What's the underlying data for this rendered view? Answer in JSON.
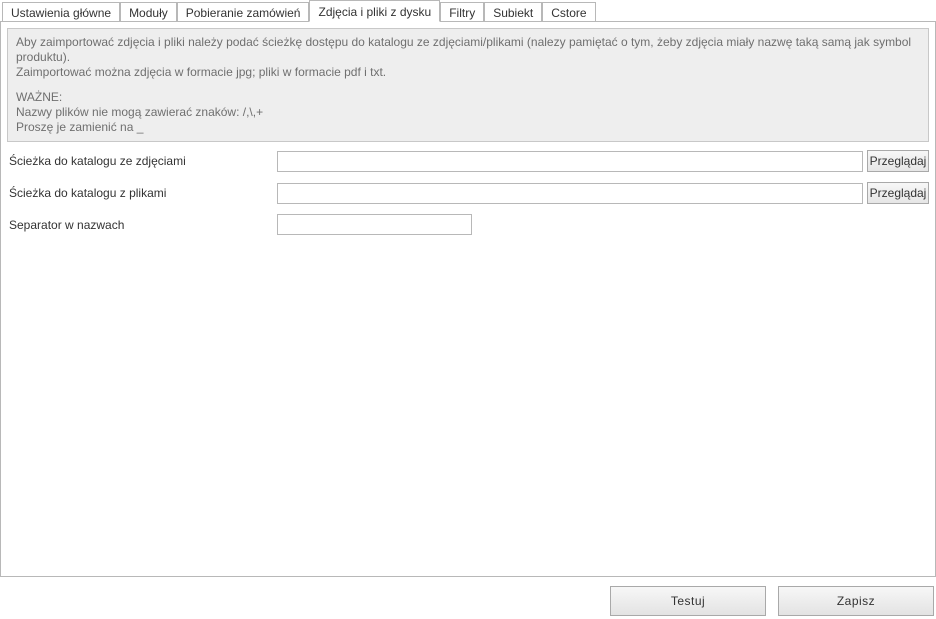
{
  "tabs": [
    {
      "label": "Ustawienia główne"
    },
    {
      "label": "Moduły"
    },
    {
      "label": "Pobieranie zamówień"
    },
    {
      "label": "Zdjęcia i pliki z dysku",
      "active": true
    },
    {
      "label": "Filtry"
    },
    {
      "label": "Subiekt"
    },
    {
      "label": "Cstore"
    }
  ],
  "info": {
    "line1": "Aby zaimportować zdjęcia i pliki należy podać ścieżkę dostępu do katalogu ze zdjęciami/plikami (nalezy pamiętać o tym, żeby zdjęcia miały nazwę taką samą jak symbol produktu).",
    "line2": "Zaimportować można zdjęcia w formacie jpg; pliki w formacie pdf i txt.",
    "line3": "WAŻNE:",
    "line4": "Nazwy plików nie mogą zawierać znaków: /,\\,+",
    "line5": "Proszę je zamienić na _"
  },
  "form": {
    "image_path_label": "Ścieżka do katalogu ze zdjęciami",
    "image_path_value": "",
    "file_path_label": "Ścieżka do katalogu z plikami",
    "file_path_value": "",
    "separator_label": "Separator w nazwach",
    "separator_value": "",
    "browse": "Przeglądaj"
  },
  "footer": {
    "test": "Testuj",
    "save": "Zapisz"
  }
}
